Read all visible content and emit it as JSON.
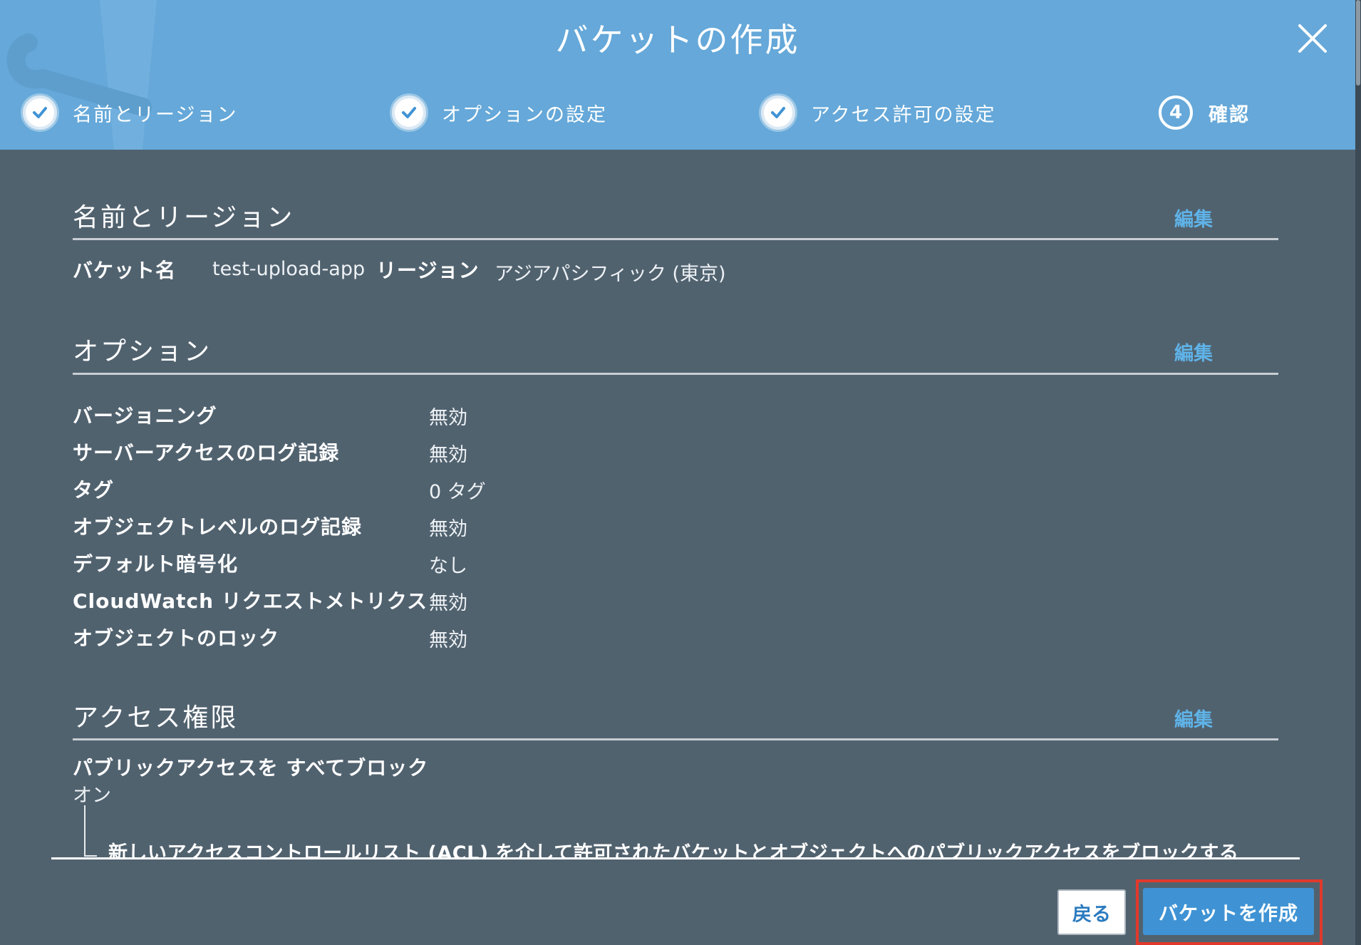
{
  "dialog": {
    "title": "バケットの作成"
  },
  "steps": [
    {
      "label": "名前とリージョン",
      "status": "done"
    },
    {
      "label": "オプションの設定",
      "status": "done"
    },
    {
      "label": "アクセス許可の設定",
      "status": "done"
    },
    {
      "label": "確認",
      "status": "current",
      "number": "4"
    }
  ],
  "sections": {
    "name_region": {
      "title": "名前とリージョン",
      "edit_label": "編集",
      "bucket_name_label": "バケット名",
      "bucket_name_value": "test-upload-app",
      "region_label": "リージョン",
      "region_value": "アジアパシフィック (東京)"
    },
    "options": {
      "title": "オプション",
      "edit_label": "編集",
      "rows": [
        {
          "label": "バージョニング",
          "value": "無効"
        },
        {
          "label": "サーバーアクセスのログ記録",
          "value": "無効"
        },
        {
          "label": "タグ",
          "value": "0 タグ"
        },
        {
          "label": "オブジェクトレベルのログ記録",
          "value": "無効"
        },
        {
          "label": "デフォルト暗号化",
          "value": "なし"
        },
        {
          "label": "CloudWatch リクエストメトリクス",
          "value": "無効"
        },
        {
          "label": "オブジェクトのロック",
          "value": "無効"
        }
      ]
    },
    "access": {
      "title": "アクセス権限",
      "edit_label": "編集",
      "block_all_label": "パブリックアクセスを すべてブロック",
      "block_all_value": "オン",
      "acl_item": "新しいアクセスコントロールリスト (ACL) を介して許可されたバケットとオブジェクトへのパブリックアクセスをブロックする"
    }
  },
  "footer": {
    "back_label": "戻る",
    "create_label": "バケットを作成"
  },
  "colors": {
    "header_bg": "#65a8d9",
    "body_bg": "#51626f",
    "link": "#5fb3e8",
    "primary_button": "#3f93d4",
    "highlight_outline": "#e0392b"
  }
}
